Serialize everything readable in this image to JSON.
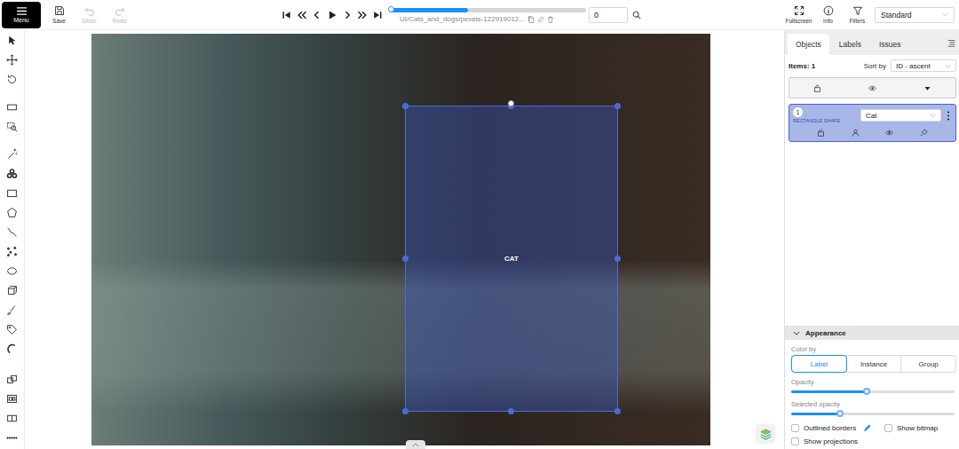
{
  "topbar": {
    "menu": "Menu",
    "actions": [
      {
        "label": "Save",
        "disabled": false
      },
      {
        "label": "Undo",
        "disabled": true
      },
      {
        "label": "Redo",
        "disabled": true
      }
    ],
    "player": {
      "level": 0,
      "loaded_level": 0.4,
      "filename": "UI/Cats_and_dogs/pexels-122919012...",
      "frame": "0"
    },
    "right_actions": [
      {
        "label": "Fullscreen"
      },
      {
        "label": "Info"
      },
      {
        "label": "Filters"
      }
    ],
    "workspace": "Standard"
  },
  "canvas": {
    "shapes": [
      {
        "label": "CAT",
        "selected": true
      }
    ]
  },
  "sidebar": {
    "tabs": [
      {
        "label": "Objects",
        "selected": true
      },
      {
        "label": "Labels",
        "selected": false
      },
      {
        "label": "Issues",
        "selected": false
      }
    ],
    "items_count": "Items: 1",
    "sort_label": "Sort by",
    "sort_value": "ID - ascent",
    "objects": [
      {
        "id": "1",
        "type": "RECTANGLE SHAPE",
        "label": "Cat",
        "selected": true
      }
    ],
    "appearance": {
      "title": "Appearance",
      "expanded": true,
      "color_by_label": "Color by",
      "color_by": [
        {
          "label": "Label",
          "selected": true
        },
        {
          "label": "Instance",
          "selected": false
        },
        {
          "label": "Group",
          "selected": false
        }
      ],
      "sliders": [
        {
          "label": "Opacity",
          "level": 0.46
        },
        {
          "label": "Selected opacity",
          "level": 0.3
        }
      ],
      "checkboxes": [
        {
          "label": "Outlined borders",
          "checked": false,
          "kind": "color-edit"
        },
        {
          "label": "Show bitmap",
          "checked": false,
          "kind": "plain"
        },
        {
          "label": "Show projections",
          "checked": false,
          "kind": "plain"
        }
      ]
    }
  }
}
